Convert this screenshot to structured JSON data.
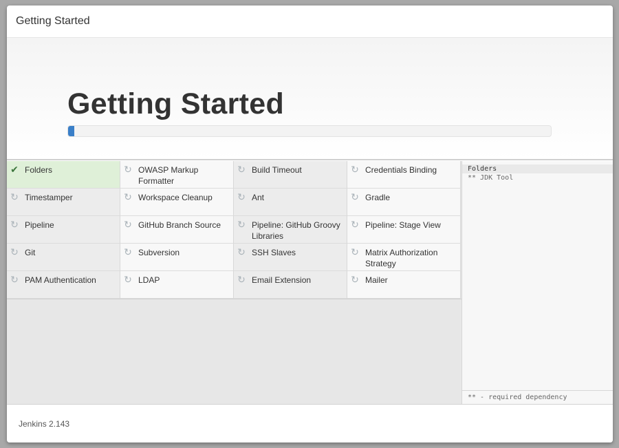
{
  "dialog": {
    "title": "Getting Started"
  },
  "hero": {
    "title": "Getting Started",
    "progress_percent": 1.3
  },
  "plugins": [
    {
      "label": "Folders",
      "status": "installed",
      "icon": "checkmark-icon"
    },
    {
      "label": "OWASP Markup Formatter",
      "status": "pending",
      "icon": "refresh-icon"
    },
    {
      "label": "Build Timeout",
      "status": "pending",
      "icon": "refresh-icon"
    },
    {
      "label": "Credentials Binding",
      "status": "pending",
      "icon": "refresh-icon"
    },
    {
      "label": "Timestamper",
      "status": "pending",
      "icon": "refresh-icon"
    },
    {
      "label": "Workspace Cleanup",
      "status": "pending",
      "icon": "refresh-icon"
    },
    {
      "label": "Ant",
      "status": "pending",
      "icon": "refresh-icon"
    },
    {
      "label": "Gradle",
      "status": "pending",
      "icon": "refresh-icon"
    },
    {
      "label": "Pipeline",
      "status": "pending",
      "icon": "refresh-icon"
    },
    {
      "label": "GitHub Branch Source",
      "status": "pending",
      "icon": "refresh-icon"
    },
    {
      "label": "Pipeline: GitHub Groovy Libraries",
      "status": "pending",
      "icon": "refresh-icon"
    },
    {
      "label": "Pipeline: Stage View",
      "status": "pending",
      "icon": "refresh-icon"
    },
    {
      "label": "Git",
      "status": "pending",
      "icon": "refresh-icon"
    },
    {
      "label": "Subversion",
      "status": "pending",
      "icon": "refresh-icon"
    },
    {
      "label": "SSH Slaves",
      "status": "pending",
      "icon": "refresh-icon"
    },
    {
      "label": "Matrix Authorization Strategy",
      "status": "pending",
      "icon": "refresh-icon"
    },
    {
      "label": "PAM Authentication",
      "status": "pending",
      "icon": "refresh-icon"
    },
    {
      "label": "LDAP",
      "status": "pending",
      "icon": "refresh-icon"
    },
    {
      "label": "Email Extension",
      "status": "pending",
      "icon": "refresh-icon"
    },
    {
      "label": "Mailer",
      "status": "pending",
      "icon": "refresh-icon"
    }
  ],
  "log": {
    "lines": [
      "Folders",
      "** JDK Tool"
    ],
    "footer": "** - required dependency"
  },
  "footer": {
    "version": "Jenkins 2.143"
  },
  "colors": {
    "accent": "#3a7fc8",
    "installed_bg": "#dff0d8",
    "installed_icon": "#3c763d",
    "pending_icon": "#aab3b9"
  }
}
